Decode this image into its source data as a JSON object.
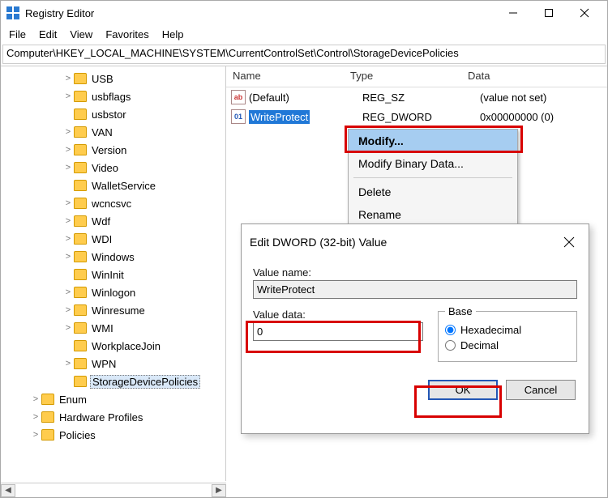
{
  "window": {
    "title": "Registry Editor"
  },
  "menu": {
    "items": [
      "File",
      "Edit",
      "View",
      "Favorites",
      "Help"
    ]
  },
  "address": "Computer\\HKEY_LOCAL_MACHINE\\SYSTEM\\CurrentControlSet\\Control\\StorageDevicePolicies",
  "tree": {
    "items": [
      {
        "label": "USB",
        "expander": ">",
        "indent": 76
      },
      {
        "label": "usbflags",
        "expander": ">",
        "indent": 76
      },
      {
        "label": "usbstor",
        "expander": "",
        "indent": 76
      },
      {
        "label": "VAN",
        "expander": ">",
        "indent": 76
      },
      {
        "label": "Version",
        "expander": ">",
        "indent": 76
      },
      {
        "label": "Video",
        "expander": ">",
        "indent": 76
      },
      {
        "label": "WalletService",
        "expander": "",
        "indent": 76
      },
      {
        "label": "wcncsvc",
        "expander": ">",
        "indent": 76
      },
      {
        "label": "Wdf",
        "expander": ">",
        "indent": 76
      },
      {
        "label": "WDI",
        "expander": ">",
        "indent": 76
      },
      {
        "label": "Windows",
        "expander": ">",
        "indent": 76
      },
      {
        "label": "WinInit",
        "expander": "",
        "indent": 76
      },
      {
        "label": "Winlogon",
        "expander": ">",
        "indent": 76
      },
      {
        "label": "Winresume",
        "expander": ">",
        "indent": 76
      },
      {
        "label": "WMI",
        "expander": ">",
        "indent": 76
      },
      {
        "label": "WorkplaceJoin",
        "expander": "",
        "indent": 76
      },
      {
        "label": "WPN",
        "expander": ">",
        "indent": 76
      },
      {
        "label": "StorageDevicePolicies",
        "expander": "",
        "indent": 76,
        "selected": true
      },
      {
        "label": "Enum",
        "expander": ">",
        "indent": 36
      },
      {
        "label": "Hardware Profiles",
        "expander": ">",
        "indent": 36
      },
      {
        "label": "Policies",
        "expander": ">",
        "indent": 36
      }
    ]
  },
  "list": {
    "headers": {
      "name": "Name",
      "type": "Type",
      "data": "Data"
    },
    "rows": [
      {
        "icon_label": "ab",
        "icon_kind": "sz",
        "name": "(Default)",
        "type": "REG_SZ",
        "data": "(value not set)",
        "selected": false
      },
      {
        "icon_label": "01",
        "icon_kind": "dword",
        "name": "WriteProtect",
        "type": "REG_DWORD",
        "data": "0x00000000 (0)",
        "selected": true
      }
    ]
  },
  "context_menu": {
    "items": [
      {
        "label": "Modify...",
        "highlighted": true,
        "bold": true
      },
      {
        "label": "Modify Binary Data..."
      },
      {
        "label": "Delete"
      },
      {
        "label": "Rename"
      }
    ]
  },
  "dialog": {
    "title": "Edit DWORD (32-bit) Value",
    "value_name_label": "Value name:",
    "value_name": "WriteProtect",
    "value_data_label": "Value data:",
    "value_data": "0",
    "base_label": "Base",
    "radio_hex": "Hexadecimal",
    "radio_dec": "Decimal",
    "base_selected": "hex",
    "ok": "OK",
    "cancel": "Cancel"
  }
}
